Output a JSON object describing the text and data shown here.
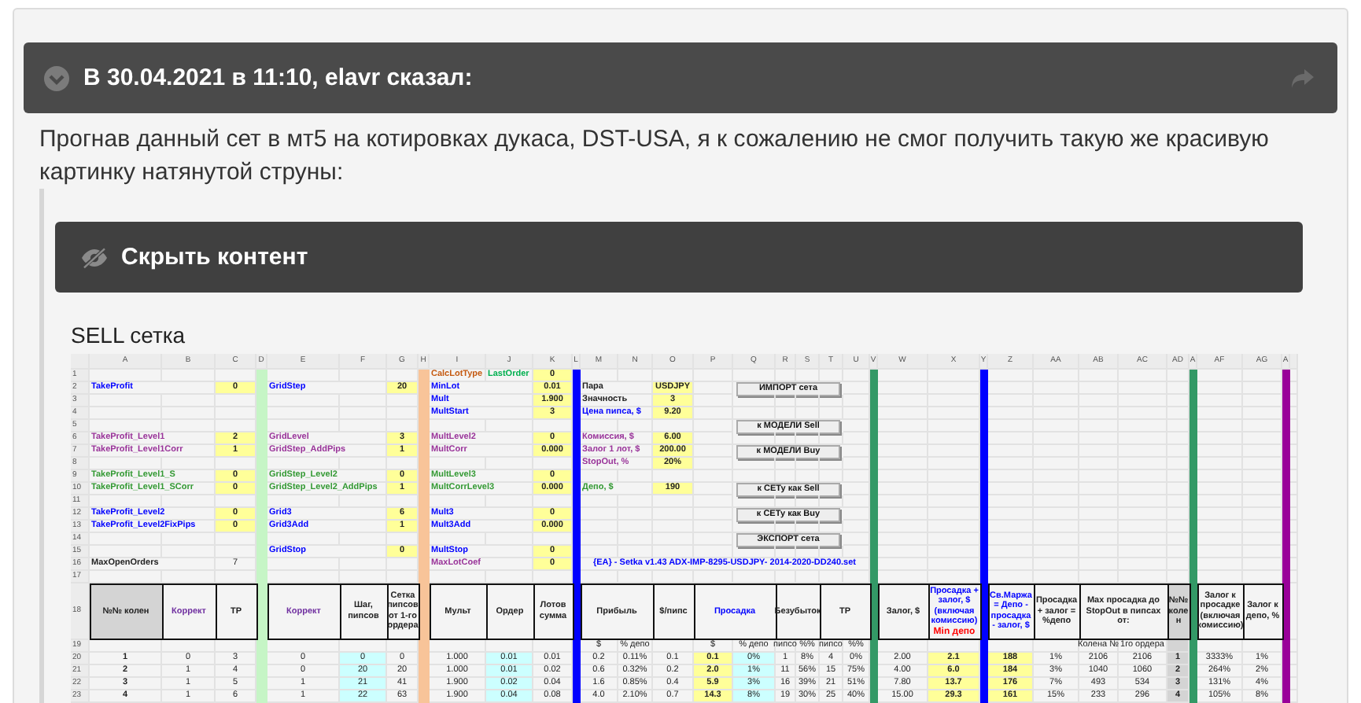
{
  "quote": {
    "header": "В 30.04.2021 в 11:10, elavr сказал:",
    "text": "Прогнав данный сет в мт5 на котировках дукаса, DST-USA, я к сожалению не смог получить такую же красивую картинку натянутой струны:"
  },
  "spoiler": {
    "label": "Скрыть контент",
    "expanded": true
  },
  "content_title": "SELL сетка",
  "sheet": {
    "columns": [
      {
        "label": "A"
      },
      {
        "label": "B"
      },
      {
        "label": "C"
      },
      {
        "label": "D",
        "color": "#c6f5c6"
      },
      {
        "label": "E"
      },
      {
        "label": "F"
      },
      {
        "label": "G"
      },
      {
        "label": "H",
        "color": "#f8c499"
      },
      {
        "label": "I"
      },
      {
        "label": "J"
      },
      {
        "label": "K"
      },
      {
        "label": "L",
        "color": "#0000ff"
      },
      {
        "label": "M"
      },
      {
        "label": "N"
      },
      {
        "label": "O"
      },
      {
        "label": "P"
      },
      {
        "label": "Q"
      },
      {
        "label": "R"
      },
      {
        "label": "S"
      },
      {
        "label": "T"
      },
      {
        "label": "U"
      },
      {
        "label": "V",
        "color": "#339966"
      },
      {
        "label": "W"
      },
      {
        "label": "X"
      },
      {
        "label": "Y",
        "color": "#0000ff"
      },
      {
        "label": "Z"
      },
      {
        "label": "AA"
      },
      {
        "label": "AB"
      },
      {
        "label": "AC"
      },
      {
        "label": "AD"
      },
      {
        "label": "A",
        "color": "#339966"
      },
      {
        "label": "AF"
      },
      {
        "label": "AG"
      },
      {
        "label": "A",
        "color": "#990099"
      }
    ],
    "rows": [
      {
        "number": "1",
        "cells": [
          {},
          {},
          {},
          {},
          {},
          {},
          {},
          {},
          {
            "kind": "label",
            "text": "CalcLotType",
            "color": "#c55a11"
          },
          {
            "kind": "label",
            "text": "LastOrder",
            "color": "#00b050"
          },
          {
            "kind": "input",
            "text": "0"
          }
        ]
      },
      {
        "number": "2",
        "cells": [
          {
            "kind": "label",
            "text": "TakeProfit",
            "color": "#0000ff"
          },
          {},
          {
            "kind": "input",
            "text": "0"
          },
          {},
          {
            "kind": "label",
            "text": "GridStep",
            "color": "#0000ff"
          },
          {},
          {
            "kind": "input",
            "text": "20"
          },
          {},
          {
            "kind": "label",
            "text": "MinLot",
            "color": "#0000ff"
          },
          {},
          {
            "kind": "input",
            "text": "0.01"
          },
          {},
          {
            "kind": "label",
            "text": "Пара"
          },
          {},
          {
            "kind": "input",
            "text": "USDJPY"
          },
          {},
          {
            "kind": "button",
            "text": "ИМПОРТ сета"
          },
          {
            "kind": "merged"
          },
          {
            "kind": "merged"
          },
          {
            "kind": "merged"
          }
        ]
      },
      {
        "number": "3",
        "cells": [
          {},
          {},
          {},
          {},
          {},
          {},
          {},
          {},
          {
            "kind": "label",
            "text": "Mult",
            "color": "#0000ff"
          },
          {},
          {
            "kind": "input",
            "text": "1.900"
          },
          {},
          {
            "kind": "label",
            "text": "Значность"
          },
          {},
          {
            "kind": "input",
            "text": "3"
          }
        ]
      },
      {
        "number": "4",
        "cells": [
          {},
          {},
          {},
          {},
          {},
          {},
          {},
          {},
          {
            "kind": "label",
            "text": "MultStart",
            "color": "#0000ff"
          },
          {},
          {
            "kind": "input",
            "text": "3"
          },
          {},
          {
            "kind": "label",
            "text": "Цена пипса, $",
            "color": "#0000ff"
          },
          {},
          {
            "kind": "input",
            "text": "9.20"
          }
        ]
      },
      {
        "number": "5",
        "cells": [
          {},
          {},
          {},
          {},
          {},
          {},
          {},
          {},
          {},
          {},
          {},
          {},
          {},
          {},
          {},
          {},
          {
            "kind": "button",
            "text": "к МОДЕЛИ Sell"
          },
          {
            "kind": "merged"
          },
          {
            "kind": "merged"
          },
          {
            "kind": "merged"
          }
        ]
      },
      {
        "number": "6",
        "cells": [
          {
            "kind": "label",
            "text": "TakeProfit_Level1",
            "color": "#993399"
          },
          {},
          {
            "kind": "input",
            "text": "2"
          },
          {},
          {
            "kind": "label",
            "text": "GridLevel",
            "color": "#993399"
          },
          {},
          {
            "kind": "input",
            "text": "3"
          },
          {},
          {
            "kind": "label",
            "text": "MultLevel2",
            "color": "#993399"
          },
          {},
          {
            "kind": "input",
            "text": "0"
          },
          {},
          {
            "kind": "label",
            "text": "Комиссия, $",
            "color": "#993399"
          },
          {},
          {
            "kind": "input",
            "text": "6.00"
          }
        ]
      },
      {
        "number": "7",
        "cells": [
          {
            "kind": "label",
            "text": "TakeProfit_Level1Corr",
            "color": "#993399"
          },
          {},
          {
            "kind": "input",
            "text": "1"
          },
          {},
          {
            "kind": "label",
            "text": "GridStep_AddPips",
            "color": "#993399"
          },
          {},
          {
            "kind": "input",
            "text": "1"
          },
          {},
          {
            "kind": "label",
            "text": "MultCorr",
            "color": "#993399"
          },
          {},
          {
            "kind": "input",
            "text": "0.000"
          },
          {},
          {
            "kind": "label",
            "text": "Залог 1 лот, $",
            "color": "#993399"
          },
          {},
          {
            "kind": "input",
            "text": "200.00"
          },
          {},
          {
            "kind": "button",
            "text": "к МОДЕЛИ Buy"
          },
          {
            "kind": "merged"
          },
          {
            "kind": "merged"
          },
          {
            "kind": "merged"
          }
        ]
      },
      {
        "number": "8",
        "cells": [
          {},
          {},
          {},
          {},
          {},
          {},
          {},
          {},
          {},
          {},
          {},
          {},
          {
            "kind": "label",
            "text": "StopOut, %",
            "color": "#993399"
          },
          {},
          {
            "kind": "input",
            "text": "20%"
          }
        ]
      },
      {
        "number": "9",
        "cells": [
          {
            "kind": "label",
            "text": "TakeProfit_Level1_S",
            "color": "#339933"
          },
          {},
          {
            "kind": "input",
            "text": "0"
          },
          {},
          {
            "kind": "label",
            "text": "GridStep_Level2",
            "color": "#339933"
          },
          {},
          {
            "kind": "input",
            "text": "0"
          },
          {},
          {
            "kind": "label",
            "text": "MultLevel3",
            "color": "#339933"
          },
          {},
          {
            "kind": "input",
            "text": "0"
          }
        ]
      },
      {
        "number": "10",
        "cells": [
          {
            "kind": "label",
            "text": "TakeProfit_Level1_SCorr",
            "color": "#339933"
          },
          {},
          {
            "kind": "input",
            "text": "0"
          },
          {},
          {
            "kind": "label",
            "text": "GridStep_Level2_AddPips",
            "color": "#339933"
          },
          {},
          {
            "kind": "input",
            "text": "1"
          },
          {},
          {
            "kind": "label",
            "text": "MultCorrLevel3",
            "color": "#339933"
          },
          {},
          {
            "kind": "input",
            "text": "0.000"
          },
          {},
          {
            "kind": "label",
            "text": "Депо, $",
            "color": "#339933"
          },
          {},
          {
            "kind": "input",
            "text": "190"
          },
          {},
          {
            "kind": "button",
            "text": "к СЕТу как Sell"
          },
          {
            "kind": "merged"
          },
          {
            "kind": "merged"
          },
          {
            "kind": "merged"
          }
        ]
      },
      {
        "number": "11"
      },
      {
        "number": "12",
        "cells": [
          {
            "kind": "label",
            "text": "TakeProfit_Level2",
            "color": "#0000ff"
          },
          {},
          {
            "kind": "input",
            "text": "0"
          },
          {},
          {
            "kind": "label",
            "text": "Grid3",
            "color": "#0000ff"
          },
          {},
          {
            "kind": "input",
            "text": "6"
          },
          {},
          {
            "kind": "label",
            "text": "Mult3",
            "color": "#0000ff"
          },
          {},
          {
            "kind": "input",
            "text": "0"
          },
          {},
          {},
          {},
          {},
          {},
          {
            "kind": "button",
            "text": "к СЕТу как Buy"
          },
          {
            "kind": "merged"
          },
          {
            "kind": "merged"
          },
          {
            "kind": "merged"
          }
        ]
      },
      {
        "number": "13",
        "cells": [
          {
            "kind": "label",
            "text": "TakeProfit_Level2FixPips",
            "color": "#0000ff"
          },
          {},
          {
            "kind": "input",
            "text": "0"
          },
          {},
          {
            "kind": "label",
            "text": "Grid3Add",
            "color": "#0000ff"
          },
          {},
          {
            "kind": "input",
            "text": "1"
          },
          {},
          {
            "kind": "label",
            "text": "Mult3Add",
            "color": "#0000ff"
          },
          {},
          {
            "kind": "input",
            "text": "0.000"
          }
        ]
      },
      {
        "number": "14",
        "cells": [
          {},
          {},
          {},
          {},
          {},
          {},
          {},
          {},
          {},
          {},
          {},
          {},
          {},
          {},
          {},
          {},
          {
            "kind": "button",
            "text": "ЭКСПОРТ сета"
          },
          {
            "kind": "merged"
          },
          {
            "kind": "merged"
          },
          {
            "kind": "merged"
          }
        ]
      },
      {
        "number": "15",
        "cells": [
          {},
          {},
          {},
          {},
          {
            "kind": "label",
            "text": "GridStop",
            "color": "#0000ff"
          },
          {},
          {
            "kind": "input",
            "text": "0"
          },
          {},
          {
            "kind": "label",
            "text": "MultStop",
            "color": "#0000ff"
          },
          {},
          {
            "kind": "input",
            "text": "0"
          }
        ]
      },
      {
        "number": "16",
        "cells": [
          {
            "kind": "label",
            "text": "MaxOpenOrders"
          },
          {},
          {
            "kind": "value",
            "text": "7"
          },
          {},
          {},
          {},
          {},
          {},
          {
            "kind": "label",
            "text": "MaxLotCoef",
            "color": "#993399"
          },
          {},
          {
            "kind": "input",
            "text": "0"
          },
          {},
          {
            "kind": "note",
            "text": "{EA} - Setka v1.43 ADX-IMP-8295-USDJPY- 2014-2020-DD240.set",
            "color": "#0000ff"
          },
          {
            "kind": "merged"
          },
          {
            "kind": "merged"
          },
          {
            "kind": "merged"
          },
          {
            "kind": "merged"
          },
          {
            "kind": "merged"
          },
          {
            "kind": "merged"
          },
          {
            "kind": "merged"
          },
          {
            "kind": "merged"
          }
        ]
      },
      {
        "number": "17"
      },
      {
        "number": "18",
        "kind": "head",
        "cells": [
          {
            "kind": "key",
            "text": "№№ колен"
          },
          {
            "kind": "head",
            "text": "Коррект",
            "color": "#7030a0"
          },
          {
            "kind": "head",
            "text": "TP"
          },
          {},
          {
            "kind": "head",
            "text": "Коррект",
            "color": "#7030a0"
          },
          {
            "kind": "head",
            "text": "Шаг, пипсов"
          },
          {
            "kind": "head",
            "text": "Сетка пипсов от 1-го ордера"
          },
          {},
          {
            "kind": "head",
            "text": "Мульт"
          },
          {
            "kind": "head",
            "text": "Ордер"
          },
          {
            "kind": "head",
            "text": "Лотов сумма"
          },
          {},
          {
            "kind": "head",
            "text": "Прибыль"
          },
          {
            "kind": "merged"
          },
          {
            "kind": "head",
            "text": "$/пипс"
          },
          {
            "kind": "head",
            "text": "Просадка",
            "color": "#0000ff"
          },
          {
            "kind": "merged"
          },
          {
            "kind": "head",
            "text": "Безубыток"
          },
          {
            "kind": "merged"
          },
          {
            "kind": "head",
            "text": "TP"
          },
          {
            "kind": "merged"
          },
          {},
          {
            "kind": "head",
            "text": "Залог, $"
          },
          {
            "kind": "head",
            "text": "Просадка + залог, $ (включая комиссию)",
            "note": "Min депо",
            "color": "#0000ff"
          },
          {},
          {
            "kind": "head",
            "text": "Св.Маржа = Депо - просадка - залог, $",
            "color": "#0000ff"
          },
          {
            "kind": "head",
            "text": "Просадка + залог = %депо"
          },
          {
            "kind": "head",
            "text": "Max просадка до StopOut в пипсах от:"
          },
          {
            "kind": "merged"
          },
          {
            "kind": "key",
            "text": "№№ колен"
          },
          {},
          {
            "kind": "head",
            "text": "Залог к просадке (включая комиссию)"
          },
          {
            "kind": "head",
            "text": "Залог к депо, %"
          }
        ]
      },
      {
        "number": "19",
        "cells": [
          {},
          {},
          {},
          {},
          {},
          {},
          {},
          {},
          {},
          {},
          {},
          {},
          {
            "kind": "value",
            "text": "$"
          },
          {
            "kind": "value",
            "text": "% депо"
          },
          {},
          {
            "kind": "value",
            "text": "$"
          },
          {
            "kind": "value",
            "text": "% депо"
          },
          {
            "kind": "value",
            "text": "пипсо"
          },
          {
            "kind": "value",
            "text": "%%"
          },
          {
            "kind": "value",
            "text": "пипсо"
          },
          {
            "kind": "value",
            "text": "%%"
          },
          {},
          {},
          {},
          {},
          {},
          {},
          {
            "kind": "value",
            "text": "Колена №"
          },
          {
            "kind": "value",
            "text": "1го ордера"
          },
          {
            "kind": "key"
          }
        ]
      },
      {
        "number": "20",
        "cells": [
          {
            "kind": "index",
            "text": "1"
          },
          {
            "kind": "value",
            "text": "0"
          },
          {
            "kind": "value",
            "text": "3"
          },
          {},
          {
            "kind": "value",
            "text": "0"
          },
          {
            "kind": "calc",
            "text": "0"
          },
          {
            "kind": "value",
            "text": "0"
          },
          {},
          {
            "kind": "value",
            "text": "1.000"
          },
          {
            "kind": "calc",
            "text": "0.01"
          },
          {
            "kind": "value",
            "text": "0.01"
          },
          {},
          {
            "kind": "value",
            "text": "0.2"
          },
          {
            "kind": "value",
            "text": "0.11%"
          },
          {
            "kind": "value",
            "text": "0.1"
          },
          {
            "kind": "input",
            "text": "0.1"
          },
          {
            "kind": "calc",
            "text": "0%"
          },
          {
            "kind": "value",
            "text": "1"
          },
          {
            "kind": "value",
            "text": "8%"
          },
          {
            "kind": "value",
            "text": "4"
          },
          {
            "kind": "value",
            "text": "0%"
          },
          {},
          {
            "kind": "value",
            "text": "2.00"
          },
          {
            "kind": "input",
            "text": "2.1"
          },
          {},
          {
            "kind": "input",
            "text": "188"
          },
          {
            "kind": "value",
            "text": "1%"
          },
          {
            "kind": "value",
            "text": "2106"
          },
          {
            "kind": "value",
            "text": "2106"
          },
          {
            "kind": "key",
            "text": "1"
          },
          {},
          {
            "kind": "value",
            "text": "3333%"
          },
          {
            "kind": "value",
            "text": "1%"
          }
        ]
      },
      {
        "number": "21",
        "cells": [
          {
            "kind": "index",
            "text": "2"
          },
          {
            "kind": "value",
            "text": "1"
          },
          {
            "kind": "value",
            "text": "4"
          },
          {},
          {
            "kind": "value",
            "text": "0"
          },
          {
            "kind": "calc",
            "text": "20"
          },
          {
            "kind": "value",
            "text": "20"
          },
          {},
          {
            "kind": "value",
            "text": "1.000"
          },
          {
            "kind": "calc",
            "text": "0.01"
          },
          {
            "kind": "value",
            "text": "0.02"
          },
          {},
          {
            "kind": "value",
            "text": "0.6"
          },
          {
            "kind": "value",
            "text": "0.32%"
          },
          {
            "kind": "value",
            "text": "0.2"
          },
          {
            "kind": "input",
            "text": "2.0"
          },
          {
            "kind": "calc",
            "text": "1%"
          },
          {
            "kind": "value",
            "text": "11"
          },
          {
            "kind": "value",
            "text": "56%"
          },
          {
            "kind": "value",
            "text": "15"
          },
          {
            "kind": "value",
            "text": "75%"
          },
          {},
          {
            "kind": "value",
            "text": "4.00"
          },
          {
            "kind": "input",
            "text": "6.0"
          },
          {},
          {
            "kind": "input",
            "text": "184"
          },
          {
            "kind": "value",
            "text": "3%"
          },
          {
            "kind": "value",
            "text": "1040"
          },
          {
            "kind": "value",
            "text": "1060"
          },
          {
            "kind": "key",
            "text": "2"
          },
          {},
          {
            "kind": "value",
            "text": "264%"
          },
          {
            "kind": "value",
            "text": "2%"
          }
        ]
      },
      {
        "number": "22",
        "cells": [
          {
            "kind": "index",
            "text": "3"
          },
          {
            "kind": "value",
            "text": "1"
          },
          {
            "kind": "value",
            "text": "5"
          },
          {},
          {
            "kind": "value",
            "text": "1"
          },
          {
            "kind": "calc",
            "text": "21"
          },
          {
            "kind": "value",
            "text": "41"
          },
          {},
          {
            "kind": "value",
            "text": "1.900"
          },
          {
            "kind": "calc",
            "text": "0.02"
          },
          {
            "kind": "value",
            "text": "0.04"
          },
          {},
          {
            "kind": "value",
            "text": "1.6"
          },
          {
            "kind": "value",
            "text": "0.85%"
          },
          {
            "kind": "value",
            "text": "0.4"
          },
          {
            "kind": "input",
            "text": "5.9"
          },
          {
            "kind": "calc",
            "text": "3%"
          },
          {
            "kind": "value",
            "text": "16"
          },
          {
            "kind": "value",
            "text": "39%"
          },
          {
            "kind": "value",
            "text": "21"
          },
          {
            "kind": "value",
            "text": "51%"
          },
          {},
          {
            "kind": "value",
            "text": "7.80"
          },
          {
            "kind": "input",
            "text": "13.7"
          },
          {},
          {
            "kind": "input",
            "text": "176"
          },
          {
            "kind": "value",
            "text": "7%"
          },
          {
            "kind": "value",
            "text": "493"
          },
          {
            "kind": "value",
            "text": "534"
          },
          {
            "kind": "key",
            "text": "3"
          },
          {},
          {
            "kind": "value",
            "text": "131%"
          },
          {
            "kind": "value",
            "text": "4%"
          }
        ]
      },
      {
        "number": "23",
        "cells": [
          {
            "kind": "index",
            "text": "4"
          },
          {
            "kind": "value",
            "text": "1"
          },
          {
            "kind": "value",
            "text": "6"
          },
          {},
          {
            "kind": "value",
            "text": "1"
          },
          {
            "kind": "calc",
            "text": "22"
          },
          {
            "kind": "value",
            "text": "63"
          },
          {},
          {
            "kind": "value",
            "text": "1.900"
          },
          {
            "kind": "calc",
            "text": "0.04"
          },
          {
            "kind": "value",
            "text": "0.08"
          },
          {},
          {
            "kind": "value",
            "text": "4.0"
          },
          {
            "kind": "value",
            "text": "2.10%"
          },
          {
            "kind": "value",
            "text": "0.7"
          },
          {
            "kind": "input",
            "text": "14.3"
          },
          {
            "kind": "calc",
            "text": "8%"
          },
          {
            "kind": "value",
            "text": "19"
          },
          {
            "kind": "value",
            "text": "30%"
          },
          {
            "kind": "value",
            "text": "25"
          },
          {
            "kind": "value",
            "text": "40%"
          },
          {},
          {
            "kind": "value",
            "text": "15.00"
          },
          {
            "kind": "input",
            "text": "29.3"
          },
          {},
          {
            "kind": "input",
            "text": "161"
          },
          {
            "kind": "value",
            "text": "15%"
          },
          {
            "kind": "value",
            "text": "233"
          },
          {
            "kind": "value",
            "text": "296"
          },
          {
            "kind": "key",
            "text": "4"
          },
          {},
          {
            "kind": "value",
            "text": "105%"
          },
          {
            "kind": "value",
            "text": "8%"
          }
        ]
      }
    ]
  }
}
